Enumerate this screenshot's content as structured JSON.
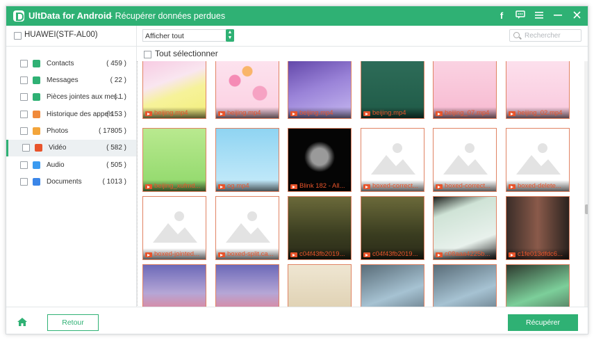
{
  "app": {
    "title": "UltData for Android",
    "subtitle": "- Récupérer données perdues",
    "brand_color": "#2fb174"
  },
  "titlebar_icons": [
    {
      "name": "facebook-icon",
      "glyph": "f"
    },
    {
      "name": "feedback-icon",
      "glyph": "☐"
    },
    {
      "name": "menu-icon",
      "glyph": "≡"
    },
    {
      "name": "minimize-icon",
      "glyph": "—"
    },
    {
      "name": "close-icon",
      "glyph": "✕"
    }
  ],
  "device": {
    "name": "HUAWEI(STF-AL00)"
  },
  "filter": {
    "selected": "Afficher tout"
  },
  "search": {
    "placeholder": "Rechercher"
  },
  "sidebar": {
    "items": [
      {
        "label": "Contacts",
        "count": "( 459 )",
        "icon": "contacts-icon",
        "color": "#2fb174"
      },
      {
        "label": "Messages",
        "count": "( 22 )",
        "icon": "messages-icon",
        "color": "#2fb174"
      },
      {
        "label": "Pièces jointes aux mes...",
        "count": "( 1 )",
        "icon": "attachments-icon",
        "color": "#2fb174"
      },
      {
        "label": "Historique des appels",
        "count": "( 153 )",
        "icon": "call-history-icon",
        "color": "#f08a3b"
      },
      {
        "label": "Photos",
        "count": "( 17805 )",
        "icon": "photos-icon",
        "color": "#f3a53b"
      },
      {
        "label": "Vidéo",
        "count": "( 582 )",
        "icon": "video-icon",
        "color": "#e8542b"
      },
      {
        "label": "Audio",
        "count": "( 505 )",
        "icon": "audio-icon",
        "color": "#3b9af0"
      },
      {
        "label": "Documents",
        "count": "( 1013 )",
        "icon": "documents-icon",
        "color": "#3b86e8"
      }
    ]
  },
  "content": {
    "select_all": "Tout sélectionner",
    "tiles": [
      {
        "caption": "beijing.mp4",
        "kind": "pink-yellow"
      },
      {
        "caption": "beijing.mp4",
        "kind": "hearts"
      },
      {
        "caption": "beijing.mp4",
        "kind": "purple"
      },
      {
        "caption": "beijing.mp4",
        "kind": "chalkboard"
      },
      {
        "caption": "beijing_07.mp4",
        "kind": "pink-star"
      },
      {
        "caption": "beijing_02.mp4",
        "kind": "pink-light"
      },
      {
        "caption": "beijing_xufmd...",
        "kind": "green-cartoon"
      },
      {
        "caption": "og.mp4",
        "kind": "sky"
      },
      {
        "caption": "Blink 182 - All...",
        "kind": "dark"
      },
      {
        "caption": "boxed-correct...",
        "kind": "placeholder"
      },
      {
        "caption": "boxed-correct...",
        "kind": "placeholder"
      },
      {
        "caption": "boxed-delete...",
        "kind": "placeholder"
      },
      {
        "caption": "boxed-jointed...",
        "kind": "placeholder"
      },
      {
        "caption": "boxed-split.ca...",
        "kind": "placeholder"
      },
      {
        "caption": "c04f43fb2019...",
        "kind": "forest"
      },
      {
        "caption": "c04f43fb2019...",
        "kind": "forest"
      },
      {
        "caption": "c08aaa4225b...",
        "kind": "screen"
      },
      {
        "caption": "c1fe013dfdc6...",
        "kind": "person"
      },
      {
        "caption": "",
        "kind": "castle"
      },
      {
        "caption": "",
        "kind": "castle"
      },
      {
        "caption": "",
        "kind": "sketch"
      },
      {
        "caption": "",
        "kind": "factory"
      },
      {
        "caption": "",
        "kind": "factory"
      },
      {
        "caption": "",
        "kind": "factory-green"
      }
    ]
  },
  "footer": {
    "back_label": "Retour",
    "recover_label": "Récupérer"
  }
}
